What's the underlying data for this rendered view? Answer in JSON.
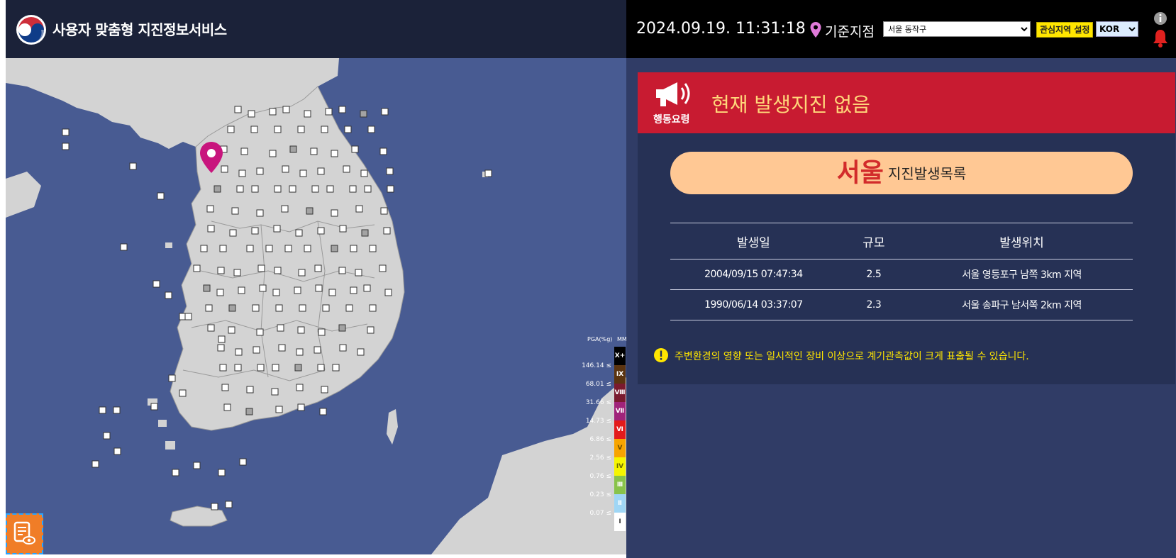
{
  "header": {
    "service_title": "사용자 맞춤형 지진정보서비스",
    "datetime": "2024.09.19. 11:31:18",
    "reference_label": "기준지점",
    "location_select": {
      "value": "서울 동작구",
      "options": [
        "서울 동작구"
      ]
    },
    "interest_button_label": "관심지역 설정",
    "language": {
      "value": "KOR",
      "options": [
        "KOR"
      ]
    },
    "icons": [
      "government-logo-icon",
      "location-pin-icon",
      "info-icon",
      "alarm-bell-icon"
    ]
  },
  "map": {
    "pga_header": "PGA(%g)",
    "mmi_header": "MMI",
    "scale": [
      {
        "pga": "146.14 ≤",
        "mmi": "X+",
        "color": "#000000",
        "text_color": "#ffffff"
      },
      {
        "pga": "68.01 ≤",
        "mmi": "IX",
        "color": "#5b3410",
        "text_color": "#ffffff"
      },
      {
        "pga": "31.66 ≤",
        "mmi": "Ⅷ",
        "color": "#7a1a2e",
        "text_color": "#ffffff"
      },
      {
        "pga": "14.73 ≤",
        "mmi": "Ⅶ",
        "color": "#a0237a",
        "text_color": "#ffffff"
      },
      {
        "pga": "6.86 ≤",
        "mmi": "Ⅵ",
        "color": "#e31b1b",
        "text_color": "#ffffff"
      },
      {
        "pga": "2.56 ≤",
        "mmi": "V",
        "color": "#f7a400",
        "text_color": "#6b4a00"
      },
      {
        "pga": "0.76 ≤",
        "mmi": "IV",
        "color": "#f5f500",
        "text_color": "#6b6b00"
      },
      {
        "pga": "0.23 ≤",
        "mmi": "Ⅲ",
        "color": "#88c34a",
        "text_color": "#ffffff"
      },
      {
        "pga": "0.07 ≤",
        "mmi": "Ⅱ",
        "color": "#9fd6f5",
        "text_color": "#ffffff"
      },
      {
        "pga": "",
        "mmi": "Ⅰ",
        "color": "#ffffff",
        "text_color": "#333333"
      }
    ]
  },
  "alert": {
    "action_label": "행동요령",
    "status_text": "현재 발생지진 없음",
    "region_name": "서울",
    "region_suffix": "지진발생목록",
    "table": {
      "headers": [
        "발생일",
        "규모",
        "발생위치"
      ],
      "rows": [
        [
          "2004/09/15 07:47:34",
          "2.5",
          "서울 영등포구 남쪽 3km 지역"
        ],
        [
          "1990/06/14 03:37:07",
          "2.3",
          "서울 송파구 남서쪽 2km 지역"
        ]
      ]
    },
    "warning_text": "주변환경의 영향 또는 일시적인 장비 이상으로 계기관측값이 크게 표출될 수 있습니다.",
    "colors": {
      "header": "#c81b31",
      "status_text": "#ffd77a",
      "pill": "#ffc894",
      "region": "#d22b2b",
      "warning": "#ffe600"
    }
  }
}
